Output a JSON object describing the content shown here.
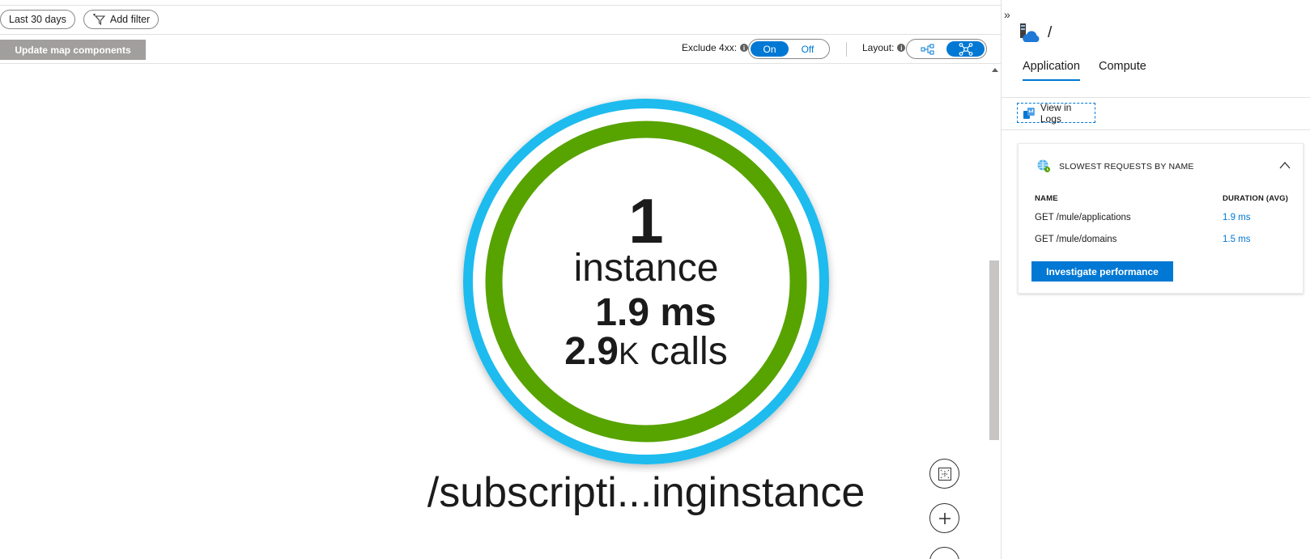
{
  "filters": {
    "time_range": "Last 30 days",
    "add_filter": "Add filter"
  },
  "toolbar": {
    "update_label": "Update map components",
    "exclude_label": "Exclude 4xx:",
    "exclude_on": "On",
    "exclude_off": "Off",
    "exclude_selected": "On",
    "layout_label": "Layout:",
    "info_icon": "i"
  },
  "node": {
    "count": "1",
    "instance_label": "instance",
    "duration": "1.9 ms",
    "calls_number": "2.9",
    "calls_unit": "K",
    "calls_label": " calls",
    "name": "/subscripti...inginstance",
    "ring_colors": {
      "outer": "#1ebbee",
      "inner": "#57a300"
    }
  },
  "panel": {
    "expand_glyph": "»",
    "resource_title": "/",
    "tabs": [
      {
        "label": "Application",
        "active": true
      },
      {
        "label": "Compute",
        "active": false
      }
    ],
    "view_logs": "View in Logs",
    "card": {
      "title": "SLOWEST REQUESTS BY NAME",
      "col_name": "NAME",
      "col_duration": "DURATION (AVG)",
      "rows": [
        {
          "name": "GET /mule/applications",
          "duration": "1.9 ms"
        },
        {
          "name": "GET /mule/domains",
          "duration": "1.5 ms"
        }
      ],
      "button": "Investigate performance"
    }
  },
  "colors": {
    "accent": "#0078d4",
    "disabled": "#a19f9d"
  }
}
